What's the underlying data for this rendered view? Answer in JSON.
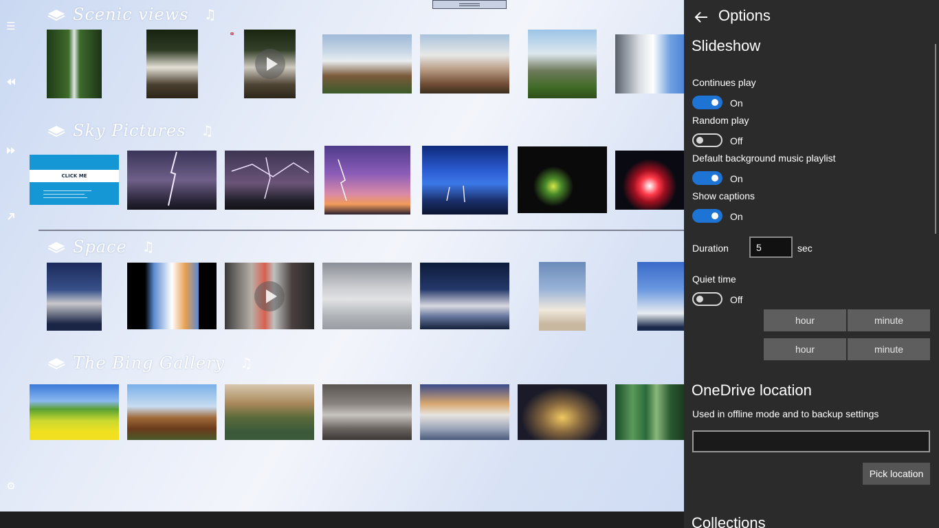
{
  "sections": [
    {
      "title": "Scenic views"
    },
    {
      "title": "Sky Pictures"
    },
    {
      "title": "Space"
    },
    {
      "title": "The Bing Gallery"
    }
  ],
  "click_card": {
    "banner": "CLICK ME"
  },
  "icons": {
    "menu": "hamburger-icon",
    "rewind": "rewind-icon",
    "fast_forward": "fast-forward-icon",
    "expand": "diagonal-arrow-icon",
    "settings": "gear-icon",
    "music": "music-note-icon",
    "section": "book-icon",
    "play": "play-icon",
    "link": "link-icon"
  },
  "panel": {
    "title": "Options",
    "slideshow_heading": "Slideshow",
    "continues_play": {
      "label": "Continues play",
      "state": "On"
    },
    "random_play": {
      "label": "Random play",
      "state": "Off"
    },
    "default_music": {
      "label": "Default background music playlist",
      "state": "On"
    },
    "show_captions": {
      "label": "Show captions",
      "state": "On"
    },
    "duration": {
      "label": "Duration",
      "value": "5",
      "unit": "sec"
    },
    "quiet_time": {
      "label": "Quiet time",
      "state": "Off"
    },
    "time_buttons": {
      "hour": "hour",
      "minute": "minute"
    },
    "onedrive_heading": "OneDrive location",
    "onedrive_desc": "Used in offline mode and to backup settings",
    "onedrive_path": "",
    "pick_location": "Pick location",
    "collections_heading": "Collections"
  },
  "colors": {
    "panel_bg": "#2b2b2b",
    "toggle_on": "#1e74d4",
    "app_bg": "#dfe8f8"
  }
}
